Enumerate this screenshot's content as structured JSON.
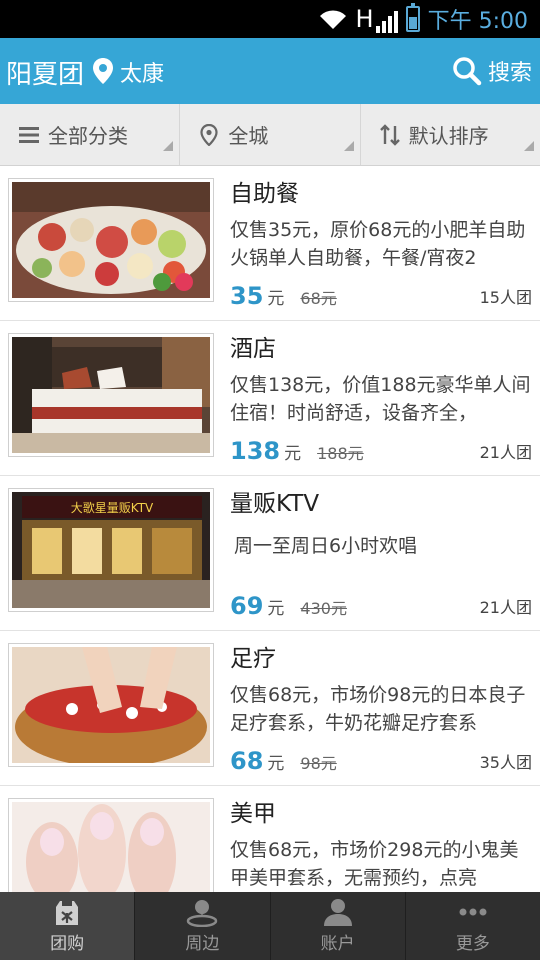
{
  "status_bar": {
    "network": "H",
    "time": "下午 5:00"
  },
  "header": {
    "title": "阳夏团",
    "city": "太康",
    "search_label": "搜索"
  },
  "filters": [
    {
      "label": "全部分类",
      "icon": "menu-icon"
    },
    {
      "label": "全城",
      "icon": "location-pin-icon"
    },
    {
      "label": "默认排序",
      "icon": "sort-icon"
    }
  ],
  "deals": [
    {
      "title": "自助餐",
      "desc": "仅售35元，原价68元的小肥羊自助火锅单人自助餐，午餐/宵夜2",
      "price": "35",
      "unit": "元",
      "original": "68元",
      "people": "15人团",
      "image": "hotpot-buffet"
    },
    {
      "title": "酒店",
      "desc": "仅售138元，价值188元豪华单人间住宿！时尚舒适，设备齐全，",
      "price": "138",
      "unit": "元",
      "original": "188元",
      "people": "21人团",
      "image": "hotel-room"
    },
    {
      "title": "量贩KTV",
      "desc": "周一至周日6小时欢唱",
      "price": "69",
      "unit": "元",
      "original": "430元",
      "people": "21人团",
      "image": "ktv-storefront",
      "sign_text": "大歌星量贩KTV"
    },
    {
      "title": "足疗",
      "desc": "仅售68元，市场价98元的日本良子足疗套系，牛奶花瓣足疗套系",
      "price": "68",
      "unit": "元",
      "original": "98元",
      "people": "35人团",
      "image": "foot-spa"
    },
    {
      "title": "美甲",
      "desc": "仅售68元，市场价298元的小鬼美甲美甲套系，无需预约，点亮",
      "price": "",
      "unit": "",
      "original": "",
      "people": "",
      "image": "manicure"
    }
  ],
  "tabs": [
    {
      "label": "团购",
      "icon": "group-buy-icon",
      "active": true
    },
    {
      "label": "周边",
      "icon": "nearby-icon",
      "active": false
    },
    {
      "label": "账户",
      "icon": "account-icon",
      "active": false
    },
    {
      "label": "更多",
      "icon": "more-icon",
      "active": false
    }
  ],
  "colors": {
    "accent": "#36a6d6",
    "price": "#2e95c8",
    "tabbar": "#2f2f2f"
  }
}
